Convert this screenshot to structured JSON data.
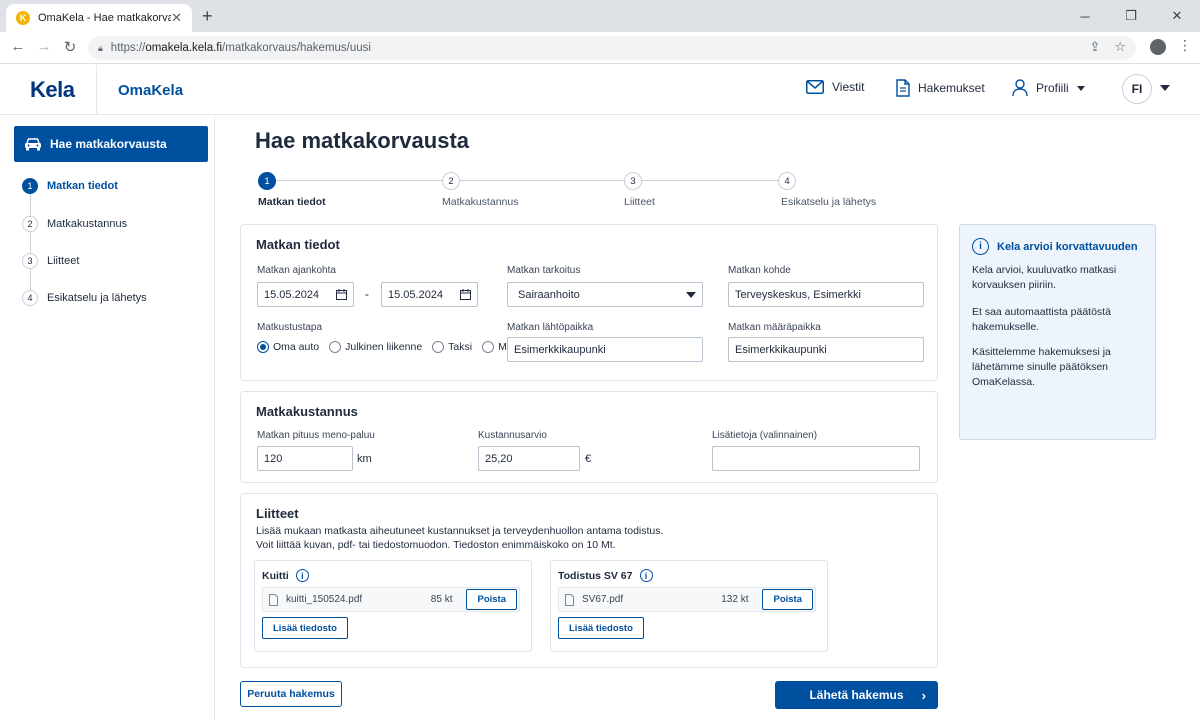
{
  "browser": {
    "tab_title": "OmaKela - Hae matkakorvausta",
    "url_prefix": "https://",
    "url_host": "omakela.kela.fi",
    "url_path": "/matkakorvaus/hakemus/uusi"
  },
  "header": {
    "logo": "Kela",
    "brand": "OmaKela",
    "nav_messages": "Viestit",
    "nav_applications": "Hakemukset",
    "nav_profile": "Profiili",
    "language": "FI"
  },
  "sidebar": {
    "cta_label": "Hae matkakorvausta",
    "steps": [
      {
        "num": "1",
        "label": "Matkan tiedot"
      },
      {
        "num": "2",
        "label": "Matkakustannus"
      },
      {
        "num": "3",
        "label": "Liitteet"
      },
      {
        "num": "4",
        "label": "Esikatselu ja lähetys"
      }
    ]
  },
  "page": {
    "title": "Hae matkakorvausta",
    "progress": [
      {
        "num": "1",
        "label": "Matkan tiedot"
      },
      {
        "num": "2",
        "label": "Matkakustannus"
      },
      {
        "num": "3",
        "label": "Liitteet"
      },
      {
        "num": "4",
        "label": "Esikatselu ja lähetys"
      }
    ]
  },
  "trip": {
    "heading": "Matkan tiedot",
    "date_label": "Matkan ajankohta",
    "date_from": "15.05.2024",
    "date_separator": "-",
    "date_to": "15.05.2024",
    "purpose_label": "Matkan tarkoitus",
    "purpose_value": "Sairaanhoito",
    "destination_label": "Matkan kohde",
    "destination_value": "Terveyskeskus, Esimerkki",
    "mode_label": "Matkustustapa",
    "modes": [
      "Oma auto",
      "Julkinen liikenne",
      "Taksi",
      "Muu"
    ],
    "mode_selected": "Oma auto",
    "origin_label": "Matkan lähtöpaikka",
    "origin_value": "Esimerkkikaupunki",
    "dest_place_label": "Matkan määräpaikka",
    "dest_place_value": "Esimerkkikaupunki"
  },
  "cost": {
    "heading": "Matkakustannus",
    "distance_label": "Matkan pituus meno-paluu",
    "distance_value": "120",
    "distance_unit": "km",
    "estimate_label": "Kustannusarvio",
    "estimate_value": "25,20",
    "estimate_unit": "€",
    "extra_label": "Lisätietoja (valinnainen)",
    "extra_value": ""
  },
  "attachments": {
    "heading": "Liitteet",
    "help_line1": "Lisää mukaan matkasta aiheutuneet kustannukset ja terveydenhuollon antama todistus.",
    "help_line2": "Voit liittää kuvan, pdf- tai tiedostomuodon. Tiedoston enimmäiskoko on 10 Mt.",
    "groups": [
      {
        "title": "Kuitti",
        "file": "kuitti_150524.pdf",
        "size": "85 kt",
        "remove": "Poista",
        "add": "Lisää tiedosto"
      },
      {
        "title": "Todistus SV 67",
        "file": "SV67.pdf",
        "size": "132 kt",
        "remove": "Poista",
        "add": "Lisää tiedosto"
      }
    ]
  },
  "actions": {
    "cancel": "Peruuta hakemus",
    "submit": "Lähetä hakemus"
  },
  "info": {
    "title": "Kela arvioi korvattavuuden",
    "p1": "Kela arvioi, kuuluvatko matkasi korvauksen piiriin.",
    "p2": "Et saa automaattista päätöstä hakemukselle.",
    "p3": "Käsittelemme hakemuksesi ja lähetämme sinulle päätöksen OmaKelassa."
  },
  "colors": {
    "accent": "#0050a0",
    "logo": "#003580",
    "info_bg": "#eef4fb"
  }
}
